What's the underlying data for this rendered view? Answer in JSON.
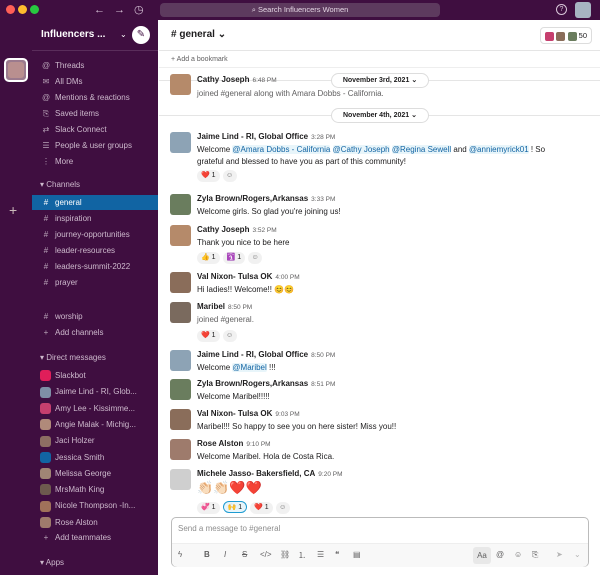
{
  "titlebar": {
    "search_placeholder": "Search Influencers Women",
    "help": "?"
  },
  "workspace": {
    "name": "Influencers ..."
  },
  "sidebar": {
    "nav": [
      {
        "icon": "threads-icon",
        "glyph": "@",
        "label": "Threads"
      },
      {
        "icon": "dms-icon",
        "glyph": "✉",
        "label": "All DMs"
      },
      {
        "icon": "at-icon",
        "glyph": "@",
        "label": "Mentions & reactions"
      },
      {
        "icon": "bookmark-icon",
        "glyph": "⎘",
        "label": "Saved items"
      },
      {
        "icon": "connect-icon",
        "glyph": "⇄",
        "label": "Slack Connect"
      },
      {
        "icon": "people-icon",
        "glyph": "☰",
        "label": "People & user groups"
      },
      {
        "icon": "more-icon",
        "glyph": "⋮",
        "label": "More"
      }
    ],
    "channels_header": "Channels",
    "channels": [
      "general",
      "inspiration",
      "journey-opportunities",
      "leader-resources",
      "leaders-summit-2022",
      "prayer",
      "worship"
    ],
    "add_channels": "Add channels",
    "dm_header": "Direct messages",
    "dms": [
      {
        "name": "Slackbot",
        "color": "#e01e5a"
      },
      {
        "name": "Jaime Lind - RI, Glob...",
        "color": "#7e8fa6"
      },
      {
        "name": "Amy Lee - Kissimme...",
        "color": "#c63f6e"
      },
      {
        "name": "Angie Malak - Michig...",
        "color": "#b08a7a"
      },
      {
        "name": "Jaci Holzer",
        "color": "#8d6e63"
      },
      {
        "name": "Jessica Smith",
        "color": "#1264a3"
      },
      {
        "name": "Melissa George",
        "color": "#a08575"
      },
      {
        "name": "MrsMath King",
        "color": "#6d5a4e"
      },
      {
        "name": "Nicole Thompson -In...",
        "color": "#a0715a"
      },
      {
        "name": "Rose Alston",
        "color": "#9e7b6c"
      }
    ],
    "add_teammates": "Add teammates",
    "apps": "Apps"
  },
  "channel": {
    "name": "# general",
    "member_count": "50",
    "bookmark": "+ Add a bookmark",
    "composer_placeholder": "Send a message to #general"
  },
  "dates": [
    "November 3rd, 2021",
    "November 4th, 2021"
  ],
  "messages": [
    {
      "name": "Cathy Joseph",
      "time": "6:48 PM",
      "text": "joined #general along with Amara Dobbs - California.",
      "color": "#b58a6a"
    },
    {
      "name": "Jaime Lind - RI, Global Office",
      "time": "3:28 PM",
      "t1": "Welcome ",
      "m1": "@Amara Dobbs - California",
      "m2": "@Cathy Joseph",
      "m3": "@Regina Sewell",
      "t2": " and ",
      "m4": "@anniemyrick01",
      "t3": " ! So",
      "line2": "grateful and blessed to have you as part of this community!",
      "color": "#8da3b5"
    },
    {
      "name": "Zyla Brown/Rogers,Arkansas",
      "time": "3:33 PM",
      "text": "Welcome girls. So glad you're joining us!",
      "color": "#6a7d5e"
    },
    {
      "name": "Cathy Joseph",
      "time": "3:52 PM",
      "text": "Thank you nice to be here",
      "color": "#b58a6a"
    },
    {
      "name": "Val Nixon- Tulsa OK",
      "time": "4:00 PM",
      "text": "Hi ladies!! Welcome!! 😊😊",
      "color": "#8a6d5a"
    },
    {
      "name": "Maribel",
      "time": "8:50 PM",
      "text": "joined #general.",
      "color": "#7a6a5e"
    },
    {
      "name": "Jaime Lind - RI, Global Office",
      "time": "8:50 PM",
      "t1": "Welcome ",
      "m1": "@Maribel",
      "t2": " !!!",
      "color": "#8da3b5"
    },
    {
      "name": "Zyla Brown/Rogers,Arkansas",
      "time": "8:51 PM",
      "text": "Welcome Maribel!!!!!",
      "color": "#6a7d5e"
    },
    {
      "name": "Val Nixon- Tulsa OK",
      "time": "9:03 PM",
      "text": "Maribel!!! So happy to see you on here sister! Miss you!!",
      "color": "#8a6d5a"
    },
    {
      "name": "Rose Alston",
      "time": "9:10 PM",
      "text": "Welcome Maribel.  Hola de Costa Rica.",
      "color": "#9e7b6c"
    },
    {
      "name": "Michele Jasso- Bakersfield, CA",
      "time": "9:20 PM",
      "text": "👏🏻👏🏻❤️❤️",
      "color": "#cfcfcf"
    }
  ],
  "reactions": {
    "r1": [
      "❤️ 1"
    ],
    "r2": [
      "👍 1",
      "🛐 1"
    ],
    "r3": [
      "❤️ 1"
    ],
    "r4": [
      "💞 1",
      "🙌 1",
      "❤️ 1"
    ]
  },
  "colors": {
    "aubergine": "#3f0e40",
    "active": "#1164a3",
    "mention": "#1264a3"
  }
}
